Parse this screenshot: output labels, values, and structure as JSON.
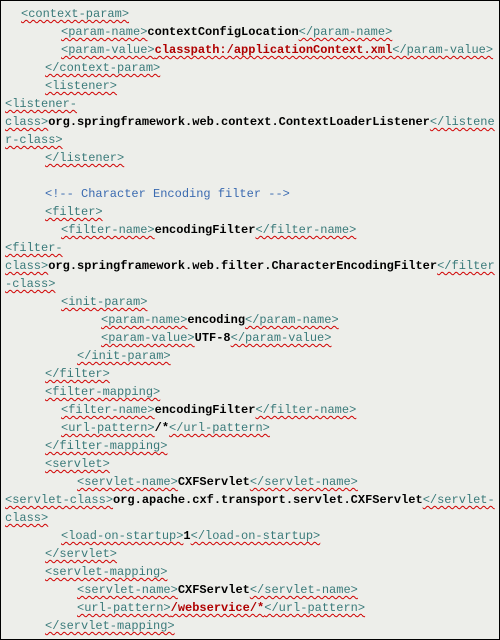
{
  "code": {
    "lines": [
      {
        "indent": "i1",
        "segs": [
          {
            "cls": "tag sq",
            "t": "<context-param>"
          }
        ]
      },
      {
        "indent": "i3",
        "segs": [
          {
            "cls": "tag sq",
            "t": "<param-name>"
          },
          {
            "cls": "bold-black",
            "t": "contextConfigLocation"
          },
          {
            "cls": "tag sq",
            "t": "</param-name>"
          }
        ]
      },
      {
        "indent": "i3",
        "segs": [
          {
            "cls": "tag sq",
            "t": "<param-value>"
          },
          {
            "cls": "bold-red sq",
            "t": "classpath:/applicationContext.xml"
          },
          {
            "cls": "tag sq",
            "t": "</param-value>"
          }
        ]
      },
      {
        "indent": "i2",
        "segs": [
          {
            "cls": "tag sq",
            "t": "</context-param>"
          }
        ]
      },
      {
        "indent": "i2",
        "segs": [
          {
            "cls": "tag sq",
            "t": "<listener>"
          }
        ]
      },
      {
        "indent": "",
        "segs": [
          {
            "cls": "tag sq",
            "t": "<listener-class>"
          },
          {
            "cls": "bold-black",
            "t": "org.springframework.web.context.ContextLoaderListener"
          },
          {
            "cls": "tag sq",
            "t": "</listener-class>"
          }
        ]
      },
      {
        "indent": "i2",
        "segs": [
          {
            "cls": "tag sq",
            "t": "</listener>"
          }
        ]
      },
      {
        "indent": "i2",
        "segs": [
          {
            "cls": "",
            "t": ""
          }
        ]
      },
      {
        "indent": "i2",
        "segs": [
          {
            "cls": "comment",
            "t": "<!-- Character Encoding filter -->"
          }
        ]
      },
      {
        "indent": "i2",
        "segs": [
          {
            "cls": "tag sq",
            "t": "<filter>"
          }
        ]
      },
      {
        "indent": "i3",
        "segs": [
          {
            "cls": "tag sq",
            "t": "<filter-name>"
          },
          {
            "cls": "bold-black",
            "t": "encodingFilter"
          },
          {
            "cls": "tag sq",
            "t": "</filter-name>"
          }
        ]
      },
      {
        "indent": "",
        "segs": [
          {
            "cls": "tag sq",
            "t": "<filter-class>"
          },
          {
            "cls": "bold-black",
            "t": "org.springframework.web.filter.CharacterEncodingFilter"
          },
          {
            "cls": "tag sq",
            "t": "</filter-class>"
          }
        ]
      },
      {
        "indent": "i3",
        "segs": [
          {
            "cls": "tag sq",
            "t": "<init-param>"
          }
        ]
      },
      {
        "indent": "i5",
        "segs": [
          {
            "cls": "tag sq",
            "t": "<param-name>"
          },
          {
            "cls": "bold-black",
            "t": "encoding"
          },
          {
            "cls": "tag sq",
            "t": "</param-name>"
          }
        ]
      },
      {
        "indent": "i5",
        "segs": [
          {
            "cls": "tag sq",
            "t": "<param-value>"
          },
          {
            "cls": "bold-black",
            "t": "UTF-8"
          },
          {
            "cls": "tag sq",
            "t": "</param-value>"
          }
        ]
      },
      {
        "indent": "i4",
        "segs": [
          {
            "cls": "tag sq",
            "t": "</init-param>"
          }
        ]
      },
      {
        "indent": "i2",
        "segs": [
          {
            "cls": "tag sq",
            "t": "</filter>"
          }
        ]
      },
      {
        "indent": "i2",
        "segs": [
          {
            "cls": "tag sq",
            "t": "<filter-mapping>"
          }
        ]
      },
      {
        "indent": "i3",
        "segs": [
          {
            "cls": "tag sq",
            "t": "<filter-name>"
          },
          {
            "cls": "bold-black",
            "t": "encodingFilter"
          },
          {
            "cls": "tag sq",
            "t": "</filter-name>"
          }
        ]
      },
      {
        "indent": "i3",
        "segs": [
          {
            "cls": "tag sq",
            "t": "<url-pattern>"
          },
          {
            "cls": "bold-black",
            "t": "/*"
          },
          {
            "cls": "tag sq",
            "t": "</url-pattern>"
          }
        ]
      },
      {
        "indent": "i2",
        "segs": [
          {
            "cls": "tag sq",
            "t": "</filter-mapping>"
          }
        ]
      },
      {
        "indent": "i2",
        "segs": [
          {
            "cls": "tag sq",
            "t": "<servlet>"
          }
        ]
      },
      {
        "indent": "i4",
        "segs": [
          {
            "cls": "tag sq",
            "t": "<servlet-name>"
          },
          {
            "cls": "bold-black",
            "t": "CXFServlet"
          },
          {
            "cls": "tag sq",
            "t": "</servlet-name>"
          }
        ]
      },
      {
        "indent": "",
        "segs": [
          {
            "cls": "tag sq",
            "t": "<servlet-class>"
          },
          {
            "cls": "bold-black",
            "t": "org.apache.cxf.transport.servlet.CXFServlet"
          },
          {
            "cls": "tag sq",
            "t": "</servlet-class>"
          }
        ]
      },
      {
        "indent": "i3",
        "segs": [
          {
            "cls": "tag sq",
            "t": "<load-on-startup>"
          },
          {
            "cls": "bold-black",
            "t": "1"
          },
          {
            "cls": "tag sq",
            "t": "</load-on-startup>"
          }
        ]
      },
      {
        "indent": "i2",
        "segs": [
          {
            "cls": "tag sq",
            "t": "</servlet>"
          }
        ]
      },
      {
        "indent": "i2",
        "segs": [
          {
            "cls": "tag sq",
            "t": "<servlet-mapping>"
          }
        ]
      },
      {
        "indent": "i4",
        "segs": [
          {
            "cls": "tag sq",
            "t": "<servlet-name>"
          },
          {
            "cls": "bold-black",
            "t": "CXFServlet"
          },
          {
            "cls": "tag sq",
            "t": "</servlet-name>"
          }
        ]
      },
      {
        "indent": "i4",
        "segs": [
          {
            "cls": "tag sq",
            "t": "<url-pattern>"
          },
          {
            "cls": "bold-red sq",
            "t": "/webservice/*"
          },
          {
            "cls": "tag sq",
            "t": "</url-pattern>"
          }
        ]
      },
      {
        "indent": "i2",
        "segs": [
          {
            "cls": "tag sq",
            "t": "</servlet-mapping>"
          }
        ]
      }
    ]
  }
}
